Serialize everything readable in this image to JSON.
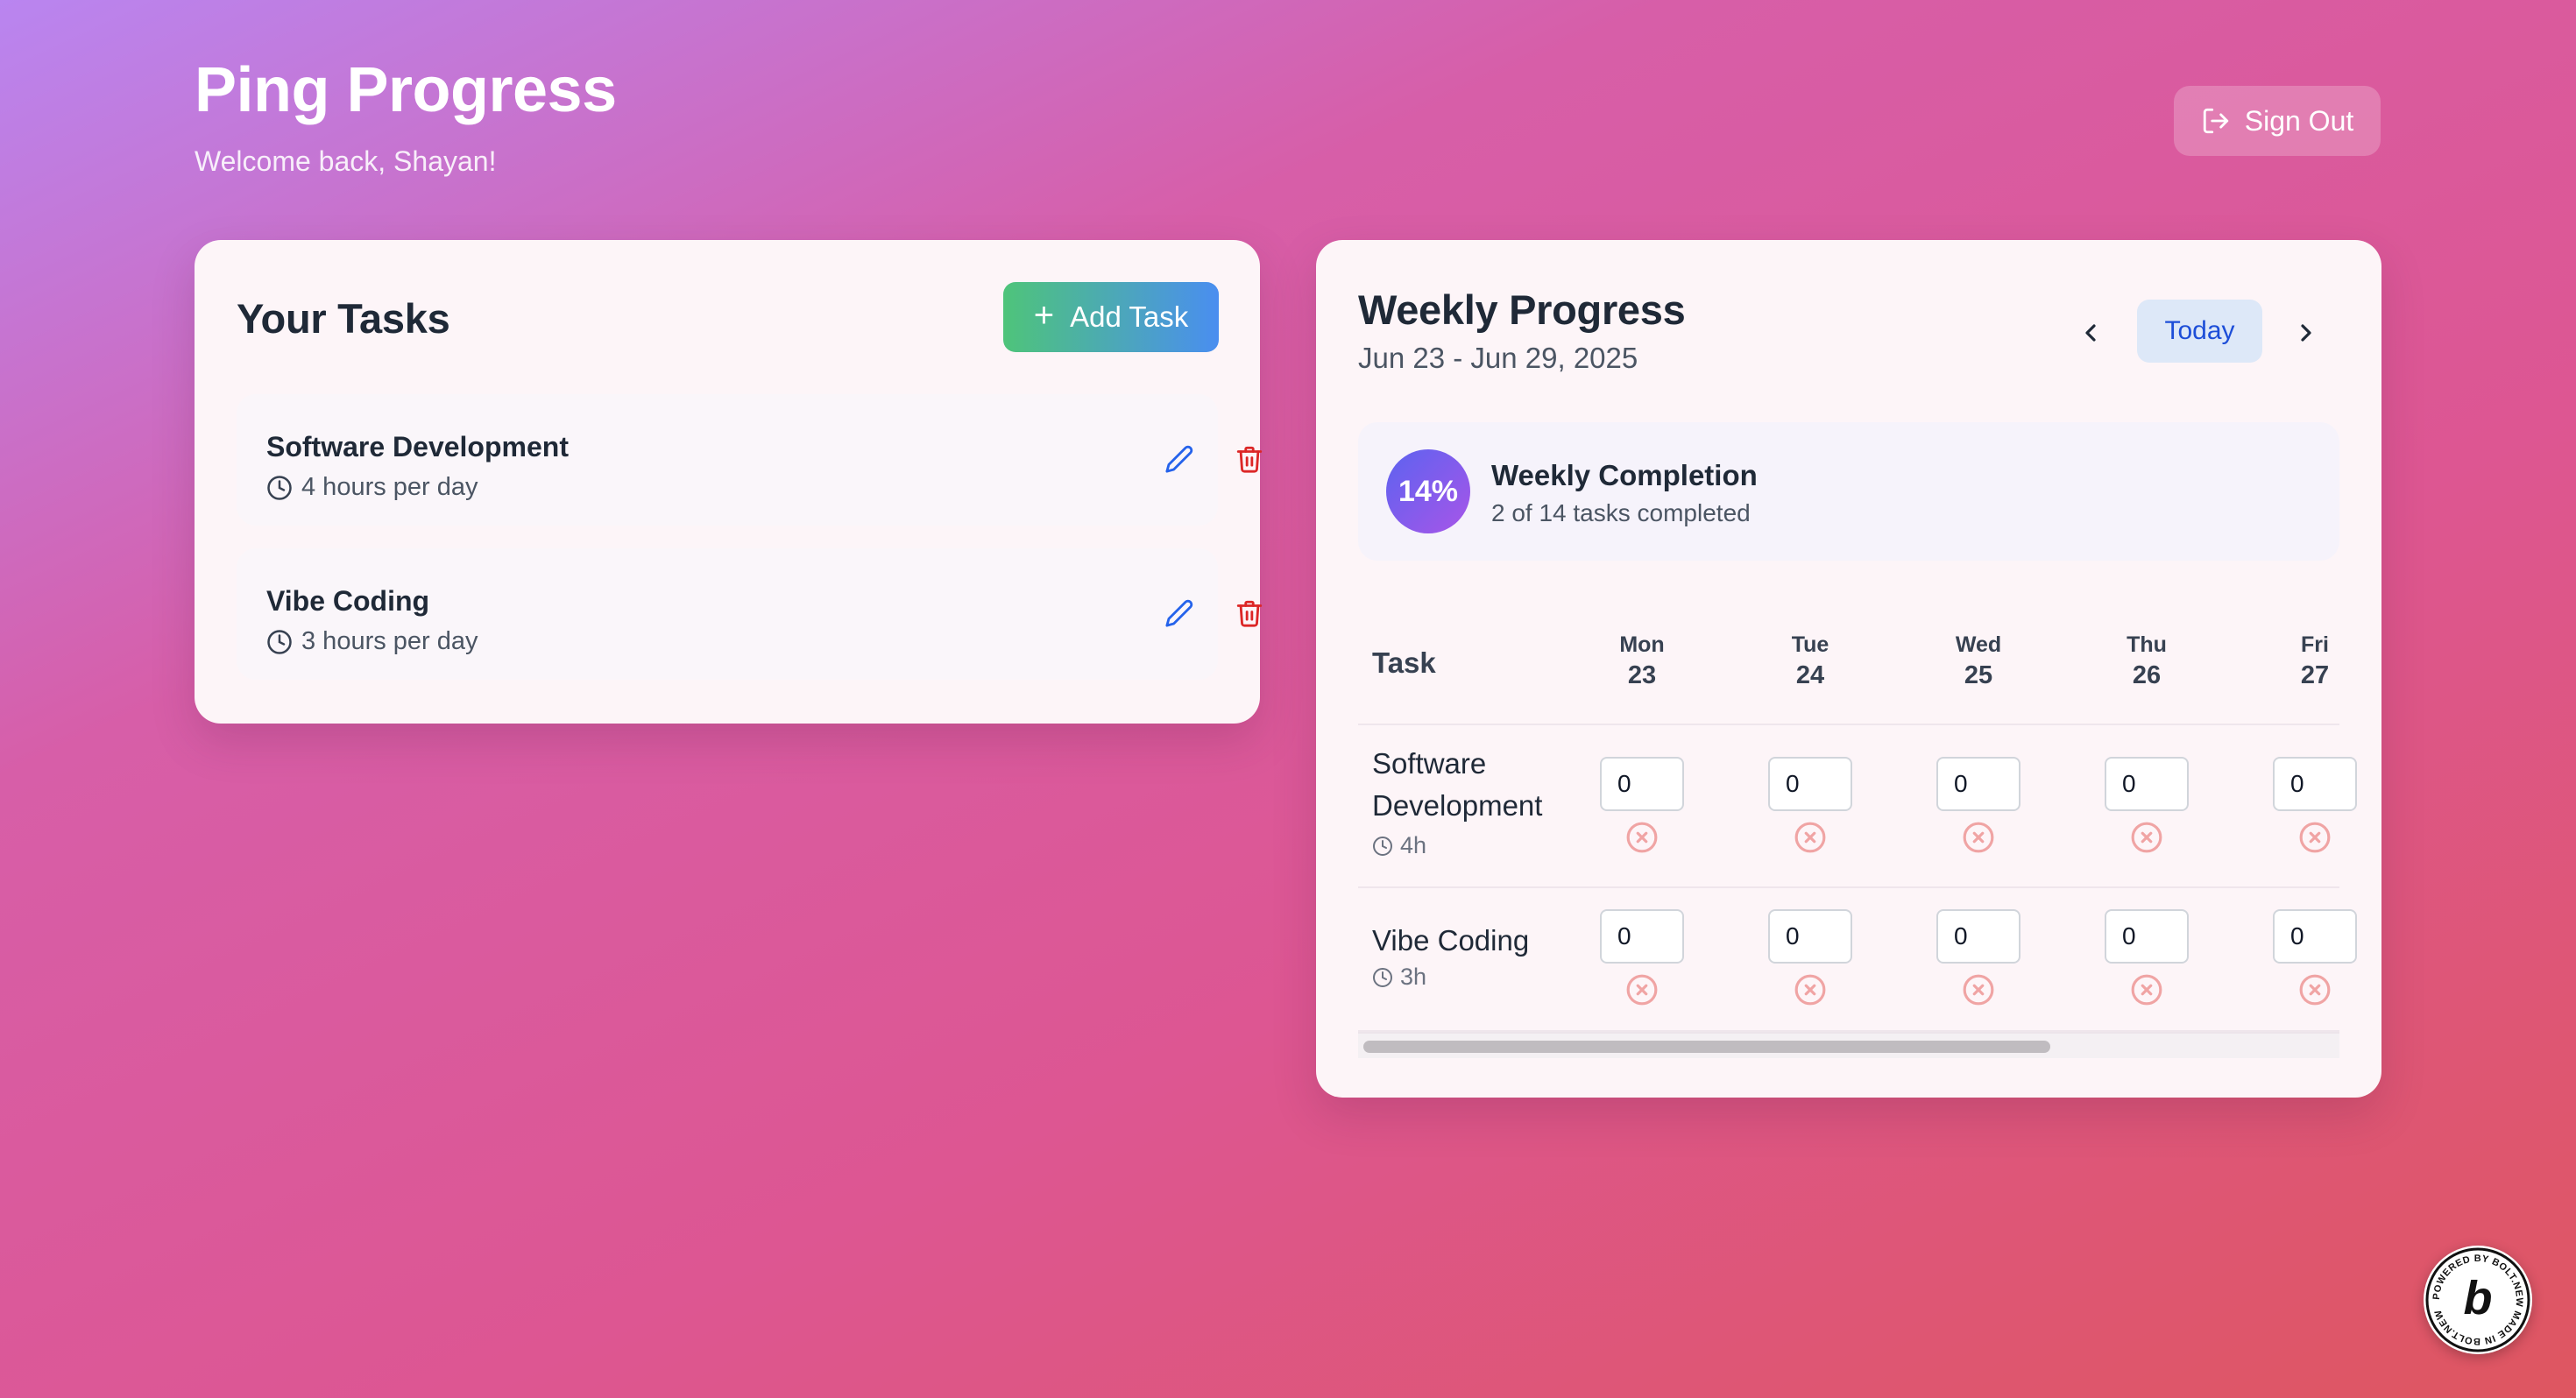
{
  "header": {
    "title": "Ping Progress",
    "subtitle": "Welcome back, Shayan!",
    "sign_out_label": "Sign Out",
    "sign_out_icon": "log-out-icon"
  },
  "tasks_panel": {
    "title": "Your Tasks",
    "add_button_label": "Add Task",
    "add_button_icon": "plus-icon",
    "items": [
      {
        "name": "Software Development",
        "hours": "4 hours per day",
        "icon": "clock-icon"
      },
      {
        "name": "Vibe Coding",
        "hours": "3 hours per day",
        "icon": "clock-icon"
      }
    ],
    "item_actions": [
      "pencil-icon",
      "trash-icon"
    ]
  },
  "progress_panel": {
    "title": "Weekly Progress",
    "date_range": "Jun 23 - Jun 29, 2025",
    "today_label": "Today",
    "nav_icons": [
      "chevron-left-icon",
      "chevron-right-icon"
    ],
    "completion": {
      "percent_label": "14%",
      "title": "Weekly Completion",
      "subtitle": "2 of 14 tasks completed"
    },
    "table": {
      "task_header": "Task",
      "days": [
        {
          "name": "Mon",
          "date": "23"
        },
        {
          "name": "Tue",
          "date": "24"
        },
        {
          "name": "Wed",
          "date": "25"
        },
        {
          "name": "Thu",
          "date": "26"
        },
        {
          "name": "Fri",
          "date": "27"
        }
      ],
      "rows": [
        {
          "name_line1": "Software",
          "name_line2": "Development",
          "hours": "4h",
          "values": [
            "0",
            "0",
            "0",
            "0",
            "0"
          ],
          "status_icon": "x-circle-icon"
        },
        {
          "name_line1": "Vibe Coding",
          "hours": "3h",
          "values": [
            "0",
            "0",
            "0",
            "0",
            "0"
          ],
          "status_icon": "x-circle-icon"
        }
      ]
    }
  },
  "badge": {
    "text": "POWERED BY BOLT.NEW MADE IN BOLT.NEW",
    "letter": "b"
  },
  "colors": {
    "accent_blue": "#1d4ed8",
    "edit_icon": "#2563eb",
    "delete_icon": "#dc2626",
    "status_missed": "#f0a4a4",
    "add_gradient_start": "#4ec47a",
    "add_gradient_end": "#4a8ef0"
  }
}
